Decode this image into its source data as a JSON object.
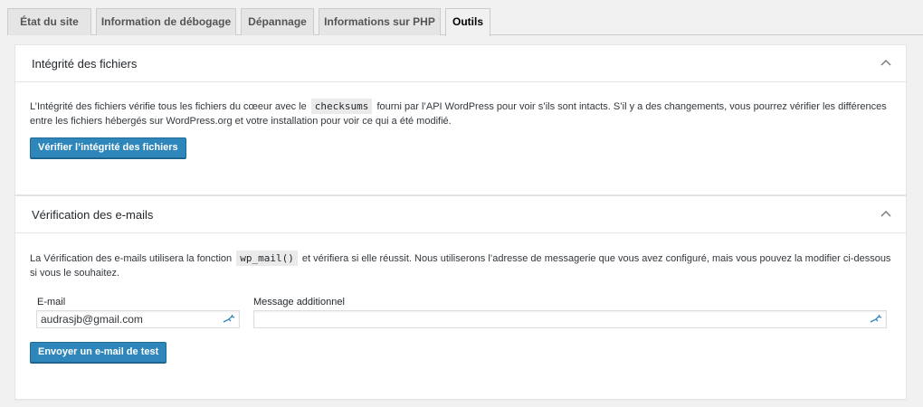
{
  "tabs": [
    {
      "label": "État du site",
      "active": false
    },
    {
      "label": "Information de débogage",
      "active": false
    },
    {
      "label": "Dépannage",
      "active": false
    },
    {
      "label": "Informations sur PHP",
      "active": false
    },
    {
      "label": "Outils",
      "active": true
    }
  ],
  "file_integrity": {
    "title": "Intégrité des fichiers",
    "desc_before": "L’Intégrité des fichiers vérifie tous les fichiers du cœeur avec le",
    "desc_code": "checksums",
    "desc_after": "fourni par l’API WordPress pour voir s’ils sont intacts. S’il y a des changements, vous pourrez vérifier les différences entre les fichiers hébergés sur WordPress.org et votre installation pour voir ce qui a été modifié.",
    "button_label": "Vérifier l’intégrité des fichiers",
    "toggle_icon": "chevron-up-icon"
  },
  "email_check": {
    "title": "Vérification des e-mails",
    "desc_before": "La Vérification des e-mails utilisera la fonction",
    "desc_code": "wp_mail()",
    "desc_after": "et vérifiera si elle réussit. Nous utiliserons l’adresse de messagerie que vous avez configuré, mais vous pouvez la modifier ci-dessous si vous le souhaitez.",
    "email_label": "E-mail",
    "email_value": "audrasjb@gmail.com",
    "message_label": "Message additionnel",
    "message_value": "",
    "button_label": "Envoyer un e-mail de test",
    "toggle_icon": "chevron-up-icon",
    "field_icon": "autofill-key-icon"
  },
  "colors": {
    "accent": "#2e86ba",
    "field_icon": "#2e86ba"
  }
}
